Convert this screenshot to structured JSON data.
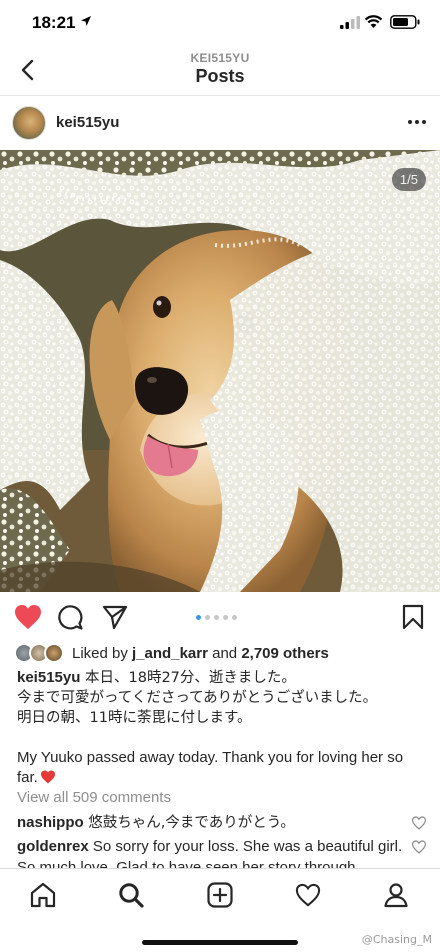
{
  "status_bar": {
    "time": "18:21"
  },
  "header": {
    "account": "KEI515YU",
    "title": "Posts"
  },
  "post": {
    "username": "kei515yu",
    "page_counter": "1/5",
    "carousel_total": 5,
    "carousel_index": 1,
    "liked": true,
    "likes": {
      "prefix": "Liked by ",
      "first_user": "j_and_karr",
      "middle": " and ",
      "count_text": "2,709 others"
    },
    "caption": {
      "username": "kei515yu",
      "jp_line1": " 本日、18時27分、逝きました。",
      "jp_line2": "今まで可愛がってくださってありがとうございました。",
      "jp_line3": "明日の朝、11時に荼毘に付します。",
      "en_text": "My Yuuko passed away today. Thank you for loving her so far."
    },
    "view_all_comments": "View all 509 comments",
    "comments": [
      {
        "username": "nashippo",
        "text": " 悠鼓ちゃん,今までありがとう。"
      },
      {
        "username": "goldenrex",
        "text": " So sorry for your loss. She was a beautiful girl. So much love. Glad to have seen her story through"
      }
    ]
  },
  "watermark": "@Chasing_M",
  "colors": {
    "like_red": "#ed4956",
    "carousel_active": "#3897f0",
    "muted": "#8e8e8e"
  },
  "icons": [
    "back-icon",
    "more-icon",
    "heart-filled-icon",
    "comment-icon",
    "share-icon",
    "bookmark-icon",
    "home-icon",
    "search-icon",
    "add-post-icon",
    "activity-icon",
    "profile-icon"
  ]
}
